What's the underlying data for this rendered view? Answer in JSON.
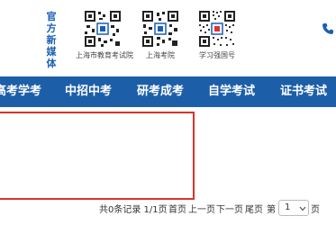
{
  "header": {
    "official_label": "官方新媒体",
    "qrcodes": [
      {
        "caption": "上海市教育考试院"
      },
      {
        "caption": "上海考院"
      },
      {
        "caption": "学习强国号"
      }
    ]
  },
  "nav": {
    "items": [
      {
        "label": "高考学考"
      },
      {
        "label": "中招中考"
      },
      {
        "label": "研考成考"
      },
      {
        "label": "自学考试"
      },
      {
        "label": "证书考试"
      }
    ]
  },
  "pager": {
    "summary": "共0条记录 1/1页",
    "first": "首页",
    "prev": "上一页",
    "next": "下一页",
    "last": "尾页",
    "goto_prefix": "第",
    "selected_page": "1",
    "goto_suffix": "页"
  },
  "colors": {
    "nav_bg": "#1d5ea8",
    "highlight_border": "#d9342b",
    "brand_text": "#1a5fb4"
  }
}
